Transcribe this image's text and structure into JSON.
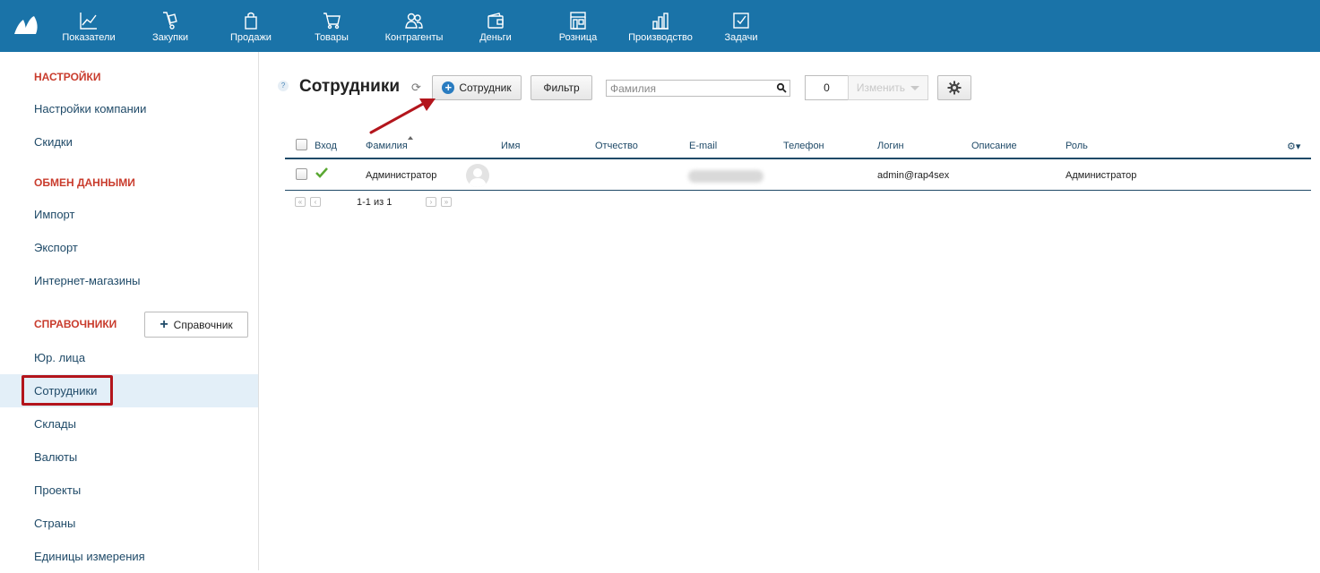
{
  "topnav": [
    {
      "label": "Показатели",
      "icon": "chart-line-icon"
    },
    {
      "label": "Закупки",
      "icon": "hand-truck-icon"
    },
    {
      "label": "Продажи",
      "icon": "shopping-bag-icon"
    },
    {
      "label": "Товары",
      "icon": "cart-icon"
    },
    {
      "label": "Контрагенты",
      "icon": "people-icon"
    },
    {
      "label": "Деньги",
      "icon": "wallet-icon"
    },
    {
      "label": "Розница",
      "icon": "store-icon"
    },
    {
      "label": "Производство",
      "icon": "factory-icon"
    },
    {
      "label": "Задачи",
      "icon": "task-check-icon"
    }
  ],
  "sidebar": {
    "sections": {
      "settings": "НАСТРОЙКИ",
      "exchange": "ОБМЕН ДАННЫМИ",
      "catalogs": "СПРАВОЧНИКИ"
    },
    "settings_items": [
      "Настройки компании",
      "Скидки"
    ],
    "exchange_items": [
      "Импорт",
      "Экспорт",
      "Интернет-магазины"
    ],
    "catalog_items": [
      "Юр. лица",
      "Сотрудники",
      "Склады",
      "Валюты",
      "Проекты",
      "Страны",
      "Единицы измерения"
    ],
    "add_catalog_label": "Справочник",
    "active_item": "Сотрудники"
  },
  "toolbar": {
    "help": "?",
    "title": "Сотрудники",
    "add_label": "Сотрудник",
    "filter_label": "Фильтр",
    "search_placeholder": "Фамилия",
    "counter": "0",
    "change_label": "Изменить"
  },
  "table": {
    "columns": [
      "Вход",
      "Фамилия",
      "Имя",
      "Отчество",
      "E-mail",
      "Телефон",
      "Логин",
      "Описание",
      "Роль"
    ],
    "rows": [
      {
        "surname": "Администратор",
        "login": "admin@rap4sex",
        "role": "Администратор"
      }
    ],
    "pagination": "1-1 из 1"
  },
  "colors": {
    "topbar": "#1a73a8",
    "section_heading": "#c93c2d",
    "link": "#1f4a68",
    "highlight": "#b3151c"
  }
}
